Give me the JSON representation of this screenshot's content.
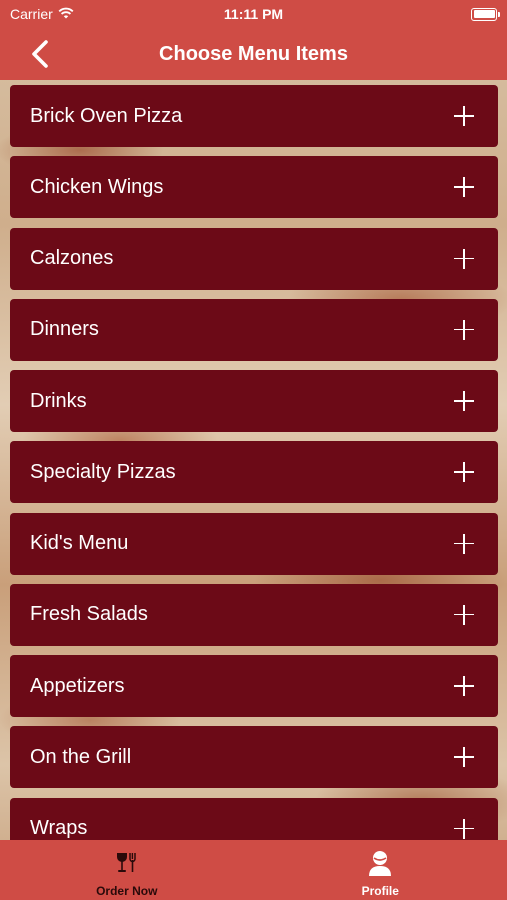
{
  "status_bar": {
    "carrier": "Carrier",
    "time": "11:11 PM"
  },
  "header": {
    "title": "Choose Menu Items",
    "background": "#cf4c45"
  },
  "menu": {
    "item_color": "#6c0a17",
    "items": [
      {
        "label": "Brick Oven Pizza",
        "icon": "plus-icon"
      },
      {
        "label": "Chicken Wings",
        "icon": "plus-icon"
      },
      {
        "label": "Calzones",
        "icon": "plus-icon"
      },
      {
        "label": "Dinners",
        "icon": "plus-icon"
      },
      {
        "label": "Drinks",
        "icon": "plus-icon"
      },
      {
        "label": "Specialty Pizzas",
        "icon": "plus-icon"
      },
      {
        "label": "Kid's Menu",
        "icon": "plus-icon"
      },
      {
        "label": "Fresh Salads",
        "icon": "plus-icon"
      },
      {
        "label": "Appetizers",
        "icon": "plus-icon"
      },
      {
        "label": "On the Grill",
        "icon": "plus-icon"
      },
      {
        "label": "Wraps",
        "icon": "plus-icon"
      }
    ]
  },
  "tab_bar": {
    "tabs": [
      {
        "label": "Order Now",
        "icon": "fork-glass-icon",
        "selected": true
      },
      {
        "label": "Profile",
        "icon": "user-icon",
        "selected": false
      }
    ]
  }
}
